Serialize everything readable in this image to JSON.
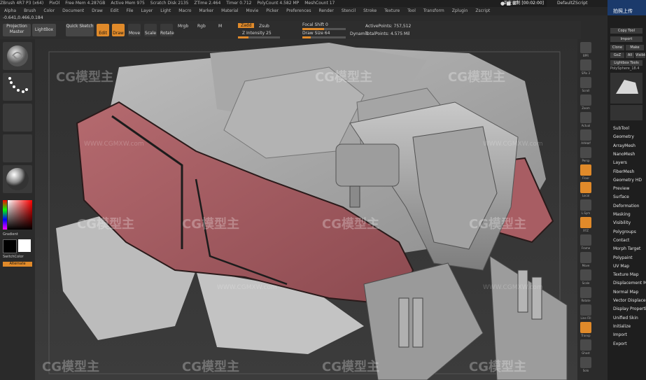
{
  "window": {
    "title_items": [
      "ZBrush 4R7 P3 (x64)",
      "PixOl",
      "Free Mem 4.287GB",
      "Active Mem 975",
      "Scratch Disk 2135",
      "ZTime 2.464",
      "Timer 0.712",
      "PolyCount 4.582 MP",
      "MeshCount 17"
    ],
    "recording": "正在录制 [00:02:00]",
    "script_label": "DefaultZScript"
  },
  "menu": [
    "Alpha",
    "Brush",
    "Color",
    "Document",
    "Draw",
    "Edit",
    "File",
    "Layer",
    "Light",
    "Macro",
    "Marker",
    "Material",
    "Movie",
    "Picker",
    "Preferences",
    "Render",
    "Stencil",
    "Stroke",
    "Texture",
    "Tool",
    "Transform",
    "Zplugin",
    "Zscript"
  ],
  "coords": "-0.641,0.466,0.184",
  "toolbar": {
    "projection_master": "Projection Master",
    "lightbox": "LightBox",
    "quick_sketch": "Quick Sketch",
    "edit": "Edit",
    "draw": "Draw",
    "move": "Move",
    "scale": "Scale",
    "rotate": "Rotate",
    "mrgb": "Mrgb",
    "rgb": "Rgb",
    "m": "M",
    "zadd": "Zadd",
    "zsub": "Zsub",
    "z_intensity_label": "Z Intensity 25",
    "z_intensity_value": 0.25,
    "focal_shift_label": "Focal Shift 0",
    "focal_shift_value": 0.5,
    "draw_size_label": "Draw Size 64",
    "draw_size_value": 0.2,
    "dynamic": "Dynamic",
    "active_points": "ActivePoints: 757,512",
    "total_points": "TotalPoints: 4.575 Mil"
  },
  "left": {
    "gradient": "Gradient",
    "switch_color": "SwitchColor",
    "alternate": "Alternate"
  },
  "shelf": [
    "BPR",
    "SPix 3",
    "Scroll",
    "Zoom",
    "Actual",
    "AAHalf",
    "Persp",
    "Floor",
    "Local",
    "L.Sym",
    "XYZ",
    "Frame",
    "Move",
    "Scale",
    "Rotate",
    "Line Fill",
    "Transp",
    "Ghost",
    "Solo"
  ],
  "tray": {
    "top_buttons": [
      "Copy Tool",
      "Import",
      "Clone",
      "Make PolyMesh3D",
      "GoZ",
      "All",
      "Visible",
      "Lightbox Tools"
    ],
    "current_tool": "PolySphere_18.4",
    "items": [
      "SubTool",
      "Geometry",
      "ArrayMesh",
      "NanoMesh",
      "Layers",
      "FiberMesh",
      "Geometry HD",
      "Preview",
      "Surface",
      "Deformation",
      "Masking",
      "Visibility",
      "Polygroups",
      "Contact",
      "Morph Target",
      "Polypaint",
      "UV Map",
      "Texture Map",
      "Displacement Map",
      "Normal Map",
      "Vector Displacement",
      "Display Properties",
      "Unified Skin",
      "Initialize",
      "Import",
      "Export"
    ],
    "top_badge": "拍照上传"
  },
  "watermark": {
    "logo": "CG模型主",
    "url": "WWW.CGMXW.com"
  }
}
